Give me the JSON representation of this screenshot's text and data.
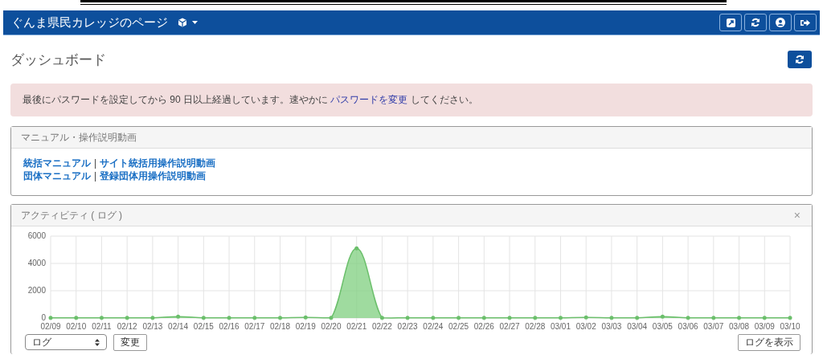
{
  "navbar": {
    "title": "ぐんま県民カレッジのページ",
    "buttons": [
      {
        "kind": "edit"
      },
      {
        "kind": "refresh"
      },
      {
        "kind": "user"
      },
      {
        "kind": "logout"
      }
    ]
  },
  "page": {
    "title": "ダッシュボード"
  },
  "alert": {
    "before": "最後にパスワードを設定してから 90 日以上経過しています。速やかに ",
    "link": "パスワードを変更",
    "after": " してください。"
  },
  "manual_panel": {
    "title": "マニュアル・操作説明動画",
    "lines": [
      {
        "links": [
          "統括マニュアル",
          "サイト統括用操作説明動画"
        ],
        "separator": "|"
      },
      {
        "links": [
          "団体マニュアル",
          "登録団体用操作説明動画"
        ],
        "separator": "|"
      }
    ]
  },
  "activity_panel": {
    "title": "アクティビティ ( ログ )",
    "close": "×",
    "select": {
      "value": "ログ"
    },
    "change_button": "変更",
    "show_log_button": "ログを表示",
    "chart_data": {
      "type": "area",
      "categories": [
        "02/09",
        "02/10",
        "02/11",
        "02/12",
        "02/13",
        "02/14",
        "02/15",
        "02/16",
        "02/17",
        "02/18",
        "02/19",
        "02/20",
        "02/21",
        "02/22",
        "02/23",
        "02/24",
        "02/25",
        "02/26",
        "02/27",
        "02/28",
        "03/01",
        "03/02",
        "03/03",
        "03/04",
        "03/05",
        "03/06",
        "03/07",
        "03/08",
        "03/09",
        "03/10"
      ],
      "grid": true,
      "series": [
        {
          "color": "#7fcf7f",
          "values": [
            10,
            10,
            10,
            10,
            20,
            100,
            20,
            10,
            10,
            10,
            40,
            10,
            5100,
            10,
            10,
            10,
            10,
            10,
            10,
            20,
            20,
            50,
            20,
            20,
            100,
            20,
            20,
            20,
            20,
            10
          ]
        }
      ],
      "ylim": [
        0,
        6000
      ],
      "yticks": [
        0,
        2000,
        4000,
        6000
      ]
    }
  }
}
